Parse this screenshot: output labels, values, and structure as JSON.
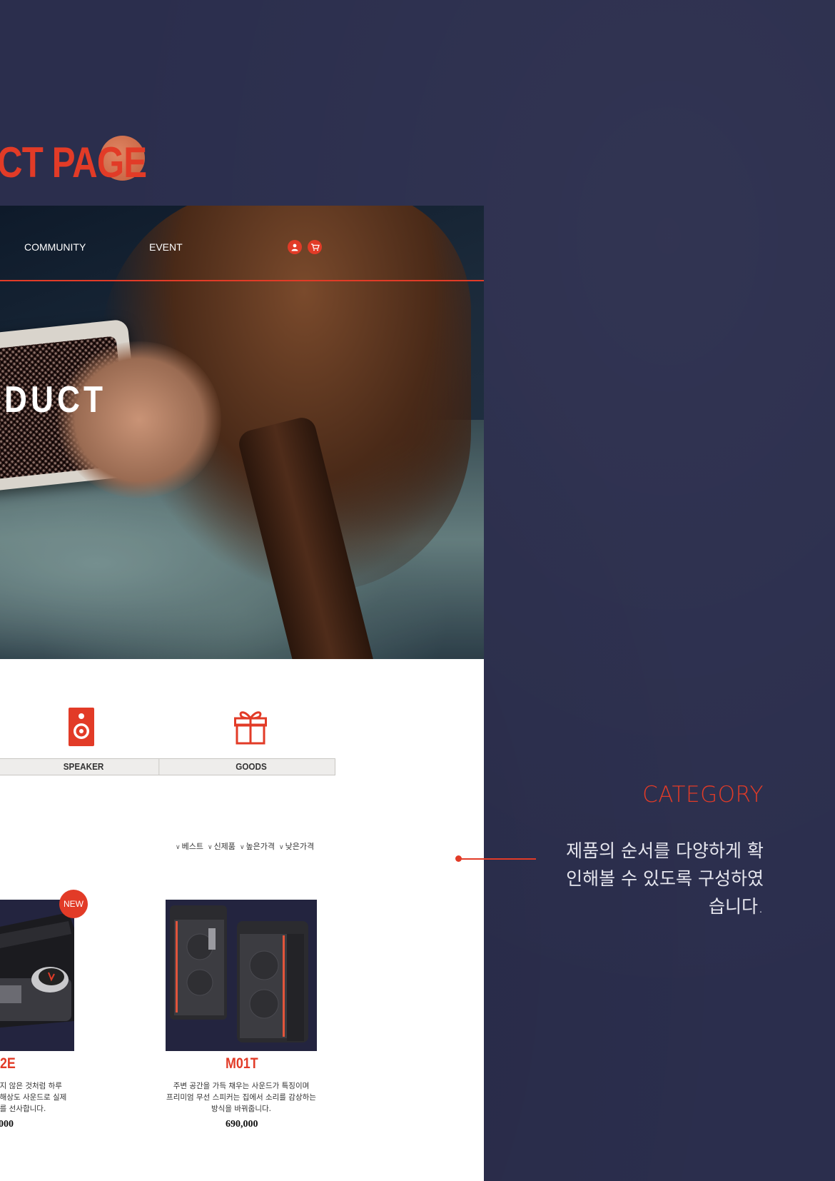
{
  "page_title": "CT PAGE",
  "hero": {
    "word": "DUCT",
    "nav": {
      "items": [
        "COMMUNITY",
        "EVENT"
      ],
      "icons": [
        "user-icon",
        "cart-icon"
      ]
    }
  },
  "categories": {
    "tabs": [
      "SPEAKER",
      "GOODS"
    ],
    "icons": [
      "speaker-icon",
      "gift-icon"
    ]
  },
  "sort": {
    "options": [
      "베스트",
      "신제품",
      "높은가격",
      "낮은가격"
    ]
  },
  "products": [
    {
      "name": "2E",
      "badge": "NEW",
      "desc_lines": [
        "듣지 않은 것처럼 하루",
        "고해상도 사운드로 실제",
        "리를 선사합니다."
      ],
      "price": "000"
    },
    {
      "name": "M01T",
      "desc_lines": [
        "주변 공간을 가득 채우는 사운드가 특징이며",
        "프리미엄 무선 스피커는 집에서 소리를 감상하는",
        "방식을 바꿔줍니다."
      ],
      "price": "690,000"
    }
  ],
  "annotation": {
    "title": "CATEGORY",
    "text_lines": [
      "제품의 순서를 다양하게 확",
      "인해볼 수 있도록 구성하였",
      "습니다."
    ]
  },
  "colors": {
    "accent": "#e23b27",
    "background": "#2b2e4d",
    "panel": "#ffffff"
  }
}
